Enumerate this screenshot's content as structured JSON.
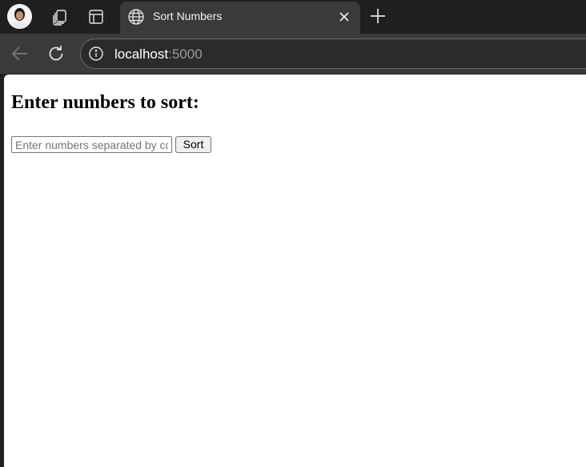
{
  "browser": {
    "tab": {
      "title": "Sort Numbers",
      "icon": "globe-icon",
      "close_icon": "close-icon"
    },
    "strip_icons": [
      "profile-avatar",
      "workspaces-icon",
      "vertical-tabs-icon",
      "new-tab-icon"
    ],
    "address": {
      "host": "localhost",
      "port": ":5000"
    },
    "colors": {
      "tabstrip": "#1f1f1f",
      "active_tab": "#3a3a3a",
      "toolbar": "#3a3a3a",
      "omnibox": "#2b2b2b"
    }
  },
  "page": {
    "heading": "Enter numbers to sort:",
    "input": {
      "value": "",
      "placeholder": "Enter numbers separated by commas"
    },
    "sort_button": "Sort"
  }
}
